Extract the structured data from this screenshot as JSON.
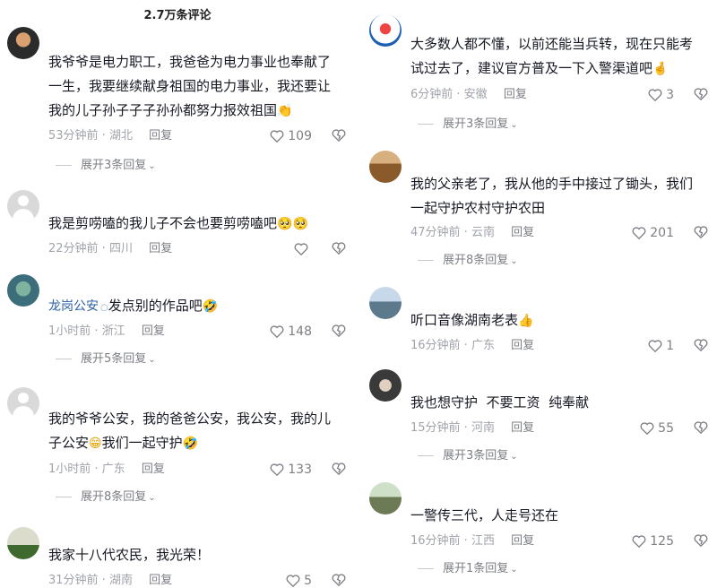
{
  "header": {
    "title": "2.7万条评论"
  },
  "left": [
    {
      "text": "我爷爷是电力职工，我爸爸为电力事业也奉献了一生，我要继续献身祖国的电力事业，我还要让我的儿子孙子子子孙孙都努力报效祖国",
      "emoji": "👏",
      "time": "53分钟前 · 湖北",
      "reply": "回复",
      "likes": "109",
      "expand": "展开3条回复"
    },
    {
      "text": "我是剪唠嗑的我儿子不会也要剪唠嗑吧",
      "emoji": "🥺🥺",
      "time": "22分钟前 · 四川",
      "reply": "回复",
      "likes": "",
      "expand": ""
    },
    {
      "author": "龙岗公安",
      "text": "发点别的作品吧",
      "emoji": "🤣",
      "time": "1小时前 · 浙江",
      "reply": "回复",
      "likes": "148",
      "expand": "展开5条回复"
    },
    {
      "text": "我的爷爷公安，我的爸爸公安，我公安，我的儿子公安",
      "emoji": "😁",
      "text2": "我们一起守护",
      "emoji2": "🤣",
      "time": "1小时前 · 广东",
      "reply": "回复",
      "likes": "133",
      "expand": "展开8条回复"
    },
    {
      "text": "我家十八代农民，我光荣！",
      "emoji": "",
      "time": "31分钟前 · 湖南",
      "reply": "回复",
      "likes": "5",
      "expand": ""
    }
  ],
  "right": [
    {
      "text": "大多数人都不懂，以前还能当兵转，现在只能考试过去了，建议官方普及一下入警渠道吧",
      "emoji": "🤞",
      "time": "6分钟前 · 安徽",
      "reply": "回复",
      "likes": "3",
      "expand": "展开3条回复"
    },
    {
      "text": "我的父亲老了，我从他的手中接过了锄头，我们一起守护农村守护农田",
      "emoji": "",
      "time": "47分钟前 · 云南",
      "reply": "回复",
      "likes": "201",
      "expand": "展开8条回复"
    },
    {
      "text": "听口音像湖南老表",
      "emoji": "👍",
      "time": "16分钟前 · 广东",
      "reply": "回复",
      "likes": "1",
      "expand": ""
    },
    {
      "text": "我也想守护  不要工资  纯奉献",
      "emoji": "",
      "time": "15分钟前 · 河南",
      "reply": "回复",
      "likes": "55",
      "expand": "展开3条回复"
    },
    {
      "text": "一警传三代，人走号还在",
      "emoji": "",
      "time": "16分钟前 · 江西",
      "reply": "回复",
      "likes": "125",
      "expand": "展开1条回复"
    }
  ],
  "icons": {
    "like": "heart-outline-icon",
    "dislike": "broken-heart-icon",
    "expand": "chevron-down-icon"
  },
  "colors": {
    "author": "#2b5fa6",
    "meta": "#a0a3ab",
    "text": "#161823"
  }
}
